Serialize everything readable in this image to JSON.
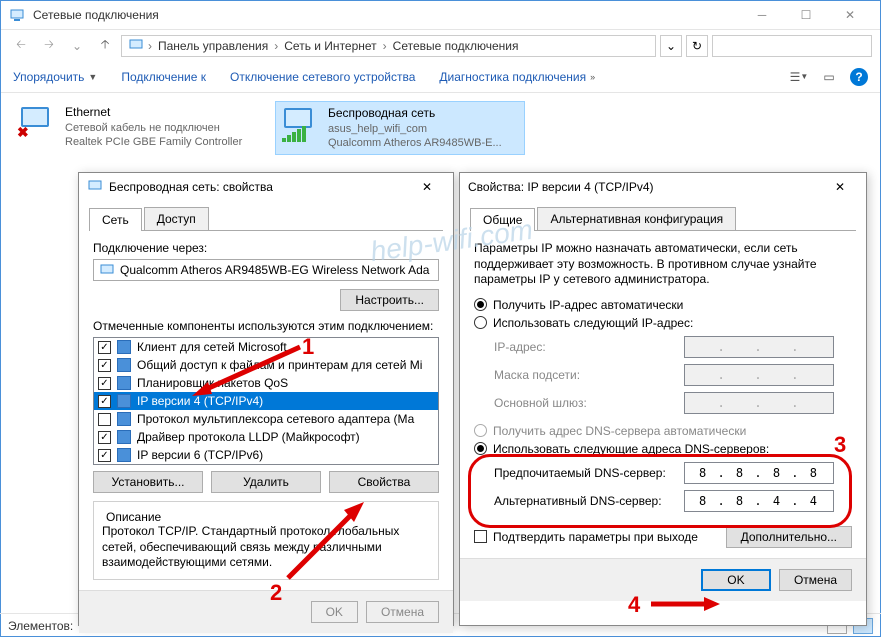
{
  "window": {
    "title": "Сетевые подключения",
    "breadcrumbs": [
      "Панель управления",
      "Сеть и Интернет",
      "Сетевые подключения"
    ],
    "search_placeholder": ""
  },
  "toolbar": {
    "organize": "Упорядочить",
    "connect": "Подключение к",
    "disable": "Отключение сетевого устройства",
    "diagnose": "Диагностика подключения"
  },
  "connections": [
    {
      "name": "Ethernet",
      "status": "Сетевой кабель не подключен",
      "adapter": "Realtek PCIe GBE Family Controller",
      "type": "wired",
      "disconnected": true
    },
    {
      "name": "Беспроводная сеть",
      "status": "asus_help_wifi_com",
      "adapter": "Qualcomm Atheros AR9485WB-E...",
      "type": "wifi",
      "selected": true
    }
  ],
  "statusbar": {
    "items": "Элементов:"
  },
  "props_dlg": {
    "title": "Беспроводная сеть: свойства",
    "tabs": [
      "Сеть",
      "Доступ"
    ],
    "connect_via_label": "Подключение через:",
    "adapter": "Qualcomm Atheros AR9485WB-EG Wireless Network Ada",
    "configure_btn": "Настроить...",
    "components_label": "Отмеченные компоненты используются этим подключением:",
    "components": [
      {
        "label": "Клиент для сетей Microsoft",
        "checked": true
      },
      {
        "label": "Общий доступ к файлам и принтерам для сетей Mi",
        "checked": true
      },
      {
        "label": "Планировщик пакетов QoS",
        "checked": true
      },
      {
        "label": "IP версии 4 (TCP/IPv4)",
        "checked": true,
        "selected": true
      },
      {
        "label": "Протокол мультиплексора сетевого адаптера (Ма",
        "checked": false
      },
      {
        "label": "Драйвер протокола LLDP (Майкрософт)",
        "checked": true
      },
      {
        "label": "IP версии 6 (TCP/IPv6)",
        "checked": true
      }
    ],
    "install_btn": "Установить...",
    "uninstall_btn": "Удалить",
    "properties_btn": "Свойства",
    "desc_title": "Описание",
    "desc_text": "Протокол TCP/IP. Стандартный протокол глобальных сетей, обеспечивающий связь между различными взаимодействующими сетями.",
    "ok": "OK",
    "cancel": "Отмена"
  },
  "ipv4_dlg": {
    "title": "Свойства: IP версии 4 (TCP/IPv4)",
    "tabs": [
      "Общие",
      "Альтернативная конфигурация"
    ],
    "intro": "Параметры IP можно назначать автоматически, если сеть поддерживает эту возможность. В противном случае узнайте параметры IP у сетевого администратора.",
    "ip_auto": "Получить IP-адрес автоматически",
    "ip_manual": "Использовать следующий IP-адрес:",
    "ip_label": "IP-адрес:",
    "mask_label": "Маска подсети:",
    "gw_label": "Основной шлюз:",
    "dns_auto": "Получить адрес DNS-сервера автоматически",
    "dns_manual": "Использовать следующие адреса DNS-серверов:",
    "dns_pref_label": "Предпочитаемый DNS-сервер:",
    "dns_alt_label": "Альтернативный DNS-сервер:",
    "dns_pref": "8 . 8 . 8 . 8",
    "dns_alt": "8 . 8 . 4 . 4",
    "validate": "Подтвердить параметры при выходе",
    "advanced": "Дополнительно...",
    "ok": "OK",
    "cancel": "Отмена"
  },
  "annotations": {
    "n1": "1",
    "n2": "2",
    "n3": "3",
    "n4": "4"
  },
  "watermark": "help-wifi.com"
}
